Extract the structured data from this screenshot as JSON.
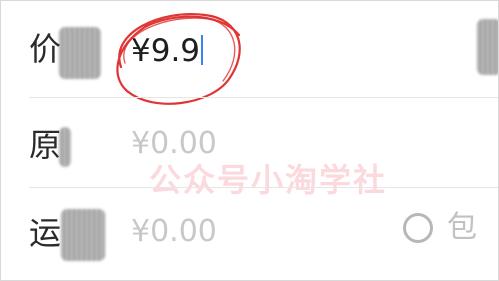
{
  "form": {
    "price": {
      "label": "价",
      "value": "¥9.9"
    },
    "original_price": {
      "label": "原",
      "placeholder": "¥0.00"
    },
    "shipping": {
      "label": "运",
      "placeholder": "¥0.00",
      "option_label": "包"
    }
  },
  "watermark": {
    "text": "公众号小淘学社"
  },
  "colors": {
    "annotation": "#e03535",
    "caret": "#3b82f6",
    "placeholder": "#c8c8c8",
    "watermark": "#ec5064"
  }
}
